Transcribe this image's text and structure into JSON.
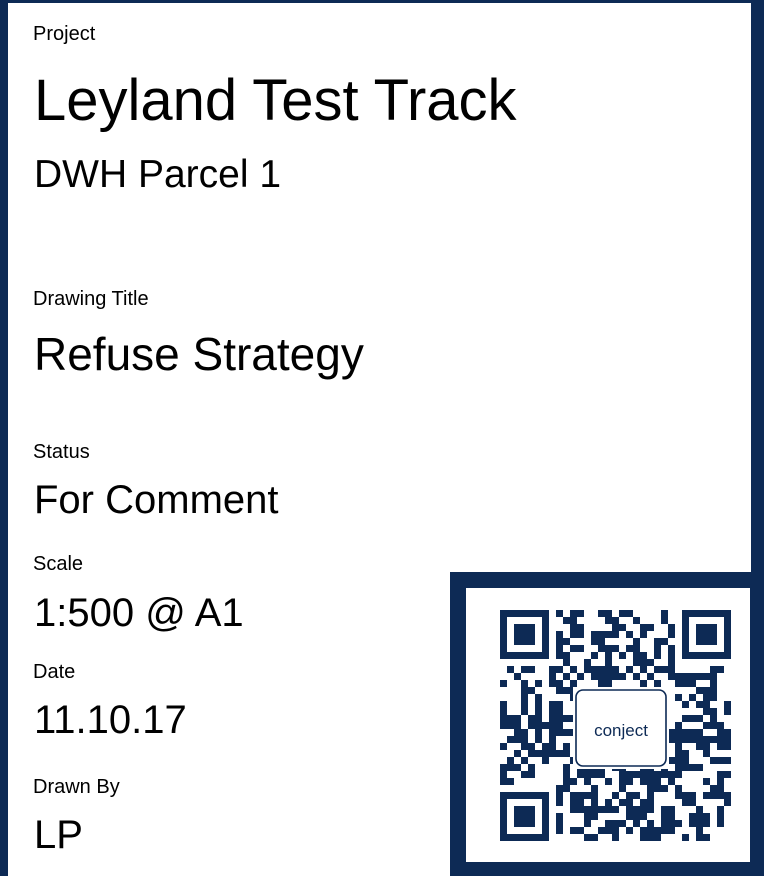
{
  "project": {
    "label": "Project",
    "name": "Leyland Test Track",
    "subtitle": "DWH Parcel 1"
  },
  "drawing_title": {
    "label": "Drawing Title",
    "value": "Refuse Strategy"
  },
  "status": {
    "label": "Status",
    "value": "For Comment"
  },
  "scale": {
    "label": "Scale",
    "value": "1:500 @ A1"
  },
  "date": {
    "label": "Date",
    "value": "11.10.17"
  },
  "drawn_by": {
    "label": "Drawn By",
    "value": "LP"
  },
  "qr": {
    "logo_text": "conject",
    "color": "#0d2a55"
  },
  "colors": {
    "frame": "#0d2a55",
    "background": "#ffffff",
    "text": "#000000"
  }
}
